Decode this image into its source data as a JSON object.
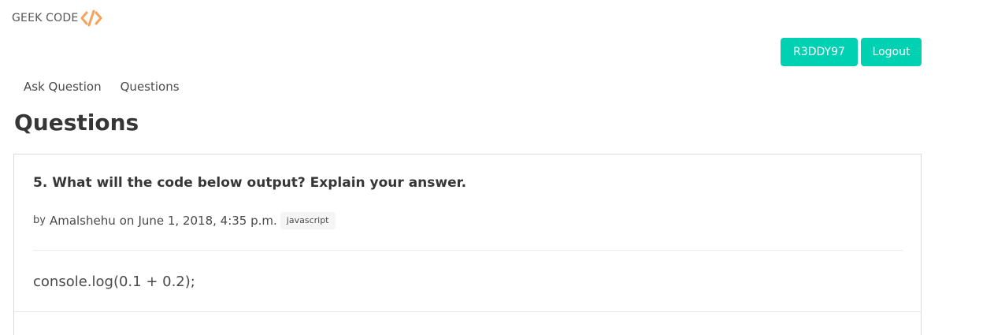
{
  "brand": {
    "text": "GEEK CODE",
    "logo_icon": "code-brackets-icon",
    "logo_color": "#f5a35c"
  },
  "user": {
    "username_label": "R3DDY97",
    "logout_label": "Logout",
    "accent": "#00d1b2"
  },
  "nav": {
    "items": [
      {
        "label": "Ask Question"
      },
      {
        "label": "Questions"
      }
    ]
  },
  "page": {
    "title": "Questions"
  },
  "question": {
    "title": "5. What will the code below output? Explain your answer.",
    "by_label": "by",
    "author": "Amalshehu",
    "on_label": "on",
    "date": "June 1, 2018, 4:35 p.m.",
    "tag": "javascript",
    "body": "console.log(0.1 + 0.2);"
  }
}
